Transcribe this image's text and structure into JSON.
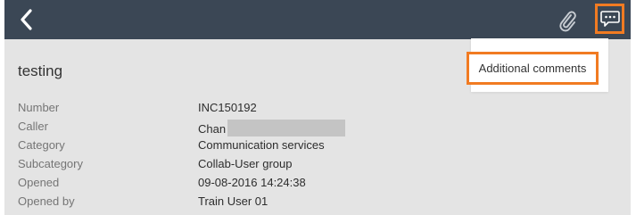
{
  "header": {
    "back_icon": "chevron-left-icon",
    "attach_icon": "paperclip-icon",
    "comments_icon": "speech-bubble-icon",
    "bar_color": "#3b4755",
    "highlight_color": "#f17b22"
  },
  "record": {
    "title": "testing",
    "fields": [
      {
        "label": "Number",
        "value": "INC150192"
      },
      {
        "label": "Caller",
        "value": "Chan"
      },
      {
        "label": "Category",
        "value": "Communication services"
      },
      {
        "label": "Subcategory",
        "value": "Collab-User group"
      },
      {
        "label": "Opened",
        "value": "09-08-2016 14:24:38"
      },
      {
        "label": "Opened by",
        "value": "Train User 01"
      }
    ]
  },
  "menu": {
    "items": [
      {
        "label": "Additional comments"
      }
    ]
  }
}
